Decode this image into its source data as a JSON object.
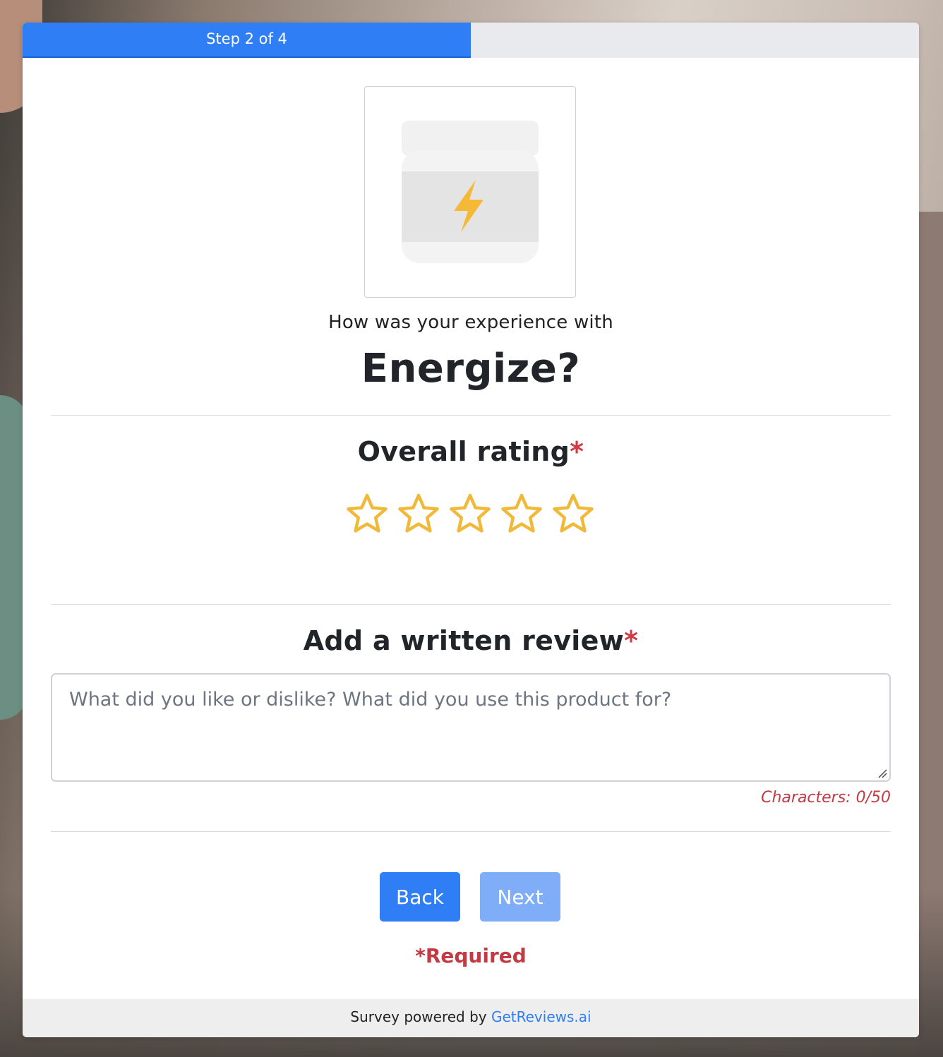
{
  "progress": {
    "label": "Step 2 of 4",
    "fraction": 0.5,
    "fill_color": "#2f7ef5"
  },
  "product": {
    "image_icon": "energy-jar-icon",
    "prompt": "How was your experience with",
    "name": "Energize?"
  },
  "rating": {
    "title": "Overall rating",
    "required_mark": "*",
    "max": 5,
    "selected": 0,
    "star_icon": "star-outline-icon",
    "star_color": "#f0b93a"
  },
  "review": {
    "title": "Add a written review",
    "required_mark": "*",
    "placeholder": "What did you like or dislike? What did you use this product for?",
    "value": "",
    "char_count_label": "Characters: 0/50"
  },
  "buttons": {
    "back": "Back",
    "next": "Next"
  },
  "required_note": "*Required",
  "footer": {
    "text": "Survey powered by ",
    "link": "GetReviews.ai"
  },
  "colors": {
    "accent": "#2f7ef5",
    "accent_disabled": "#7fadf8",
    "required": "#c23a44"
  }
}
